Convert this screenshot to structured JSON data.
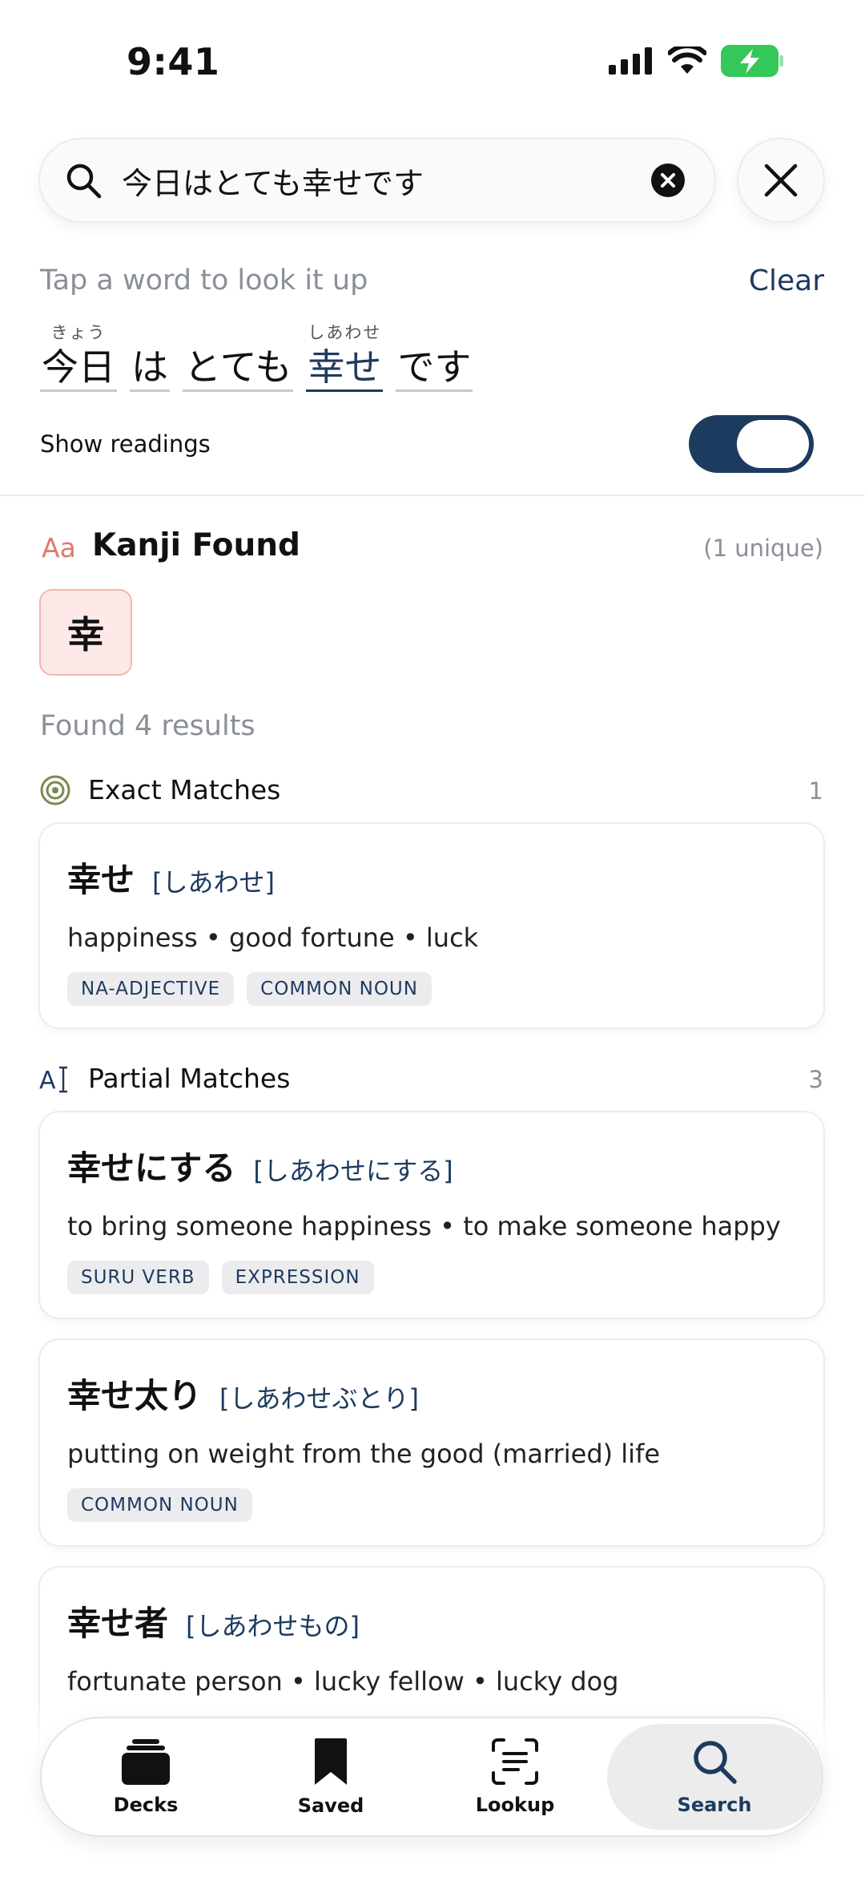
{
  "status_bar": {
    "time": "9:41"
  },
  "search": {
    "query": "今日はとても幸せです"
  },
  "hint": {
    "text": "Tap a word to look it up",
    "clear_label": "Clear"
  },
  "tokens": [
    {
      "surface": "今日",
      "reading": "きょう"
    },
    {
      "surface": "は",
      "reading": ""
    },
    {
      "surface": "とても",
      "reading": ""
    },
    {
      "surface": "幸せ",
      "reading": "しあわせ"
    },
    {
      "surface": "です",
      "reading": ""
    }
  ],
  "readings": {
    "label": "Show readings",
    "enabled": true
  },
  "kanji_found": {
    "icon_text": "Aa",
    "title": "Kanji Found",
    "count": "(1 unique)",
    "kanji": [
      "幸"
    ]
  },
  "results": {
    "summary": "Found 4 results"
  },
  "exact": {
    "title": "Exact Matches",
    "count": "1",
    "entries": [
      {
        "word": "幸せ",
        "reading": "[しあわせ]",
        "meaning": "happiness • good fortune • luck",
        "tags": [
          "NA-ADJECTIVE",
          "COMMON NOUN"
        ]
      }
    ]
  },
  "partial": {
    "title": "Partial Matches",
    "count": "3",
    "entries": [
      {
        "word": "幸せにする",
        "reading": "[しあわせにする]",
        "meaning": "to bring someone happiness • to make someone happy",
        "tags": [
          "SURU VERB",
          "EXPRESSION"
        ]
      },
      {
        "word": "幸せ太り",
        "reading": "[しあわせぶとり]",
        "meaning": "putting on weight from the good (married) life",
        "tags": [
          "COMMON NOUN"
        ]
      },
      {
        "word": "幸せ者",
        "reading": "[しあわせもの]",
        "meaning": "fortunate person • lucky fellow • lucky dog",
        "tags": []
      }
    ]
  },
  "nav": {
    "items": [
      {
        "label": "Decks",
        "icon": "decks-icon"
      },
      {
        "label": "Saved",
        "icon": "bookmark-icon"
      },
      {
        "label": "Lookup",
        "icon": "scan-text-icon"
      },
      {
        "label": "Search",
        "icon": "search-icon"
      }
    ],
    "active": "Search"
  },
  "colors": {
    "accent": "#1d3a5f",
    "kanji_tile_bg": "#fde9e7",
    "tag_bg": "#ececef",
    "battery": "#34c759"
  }
}
